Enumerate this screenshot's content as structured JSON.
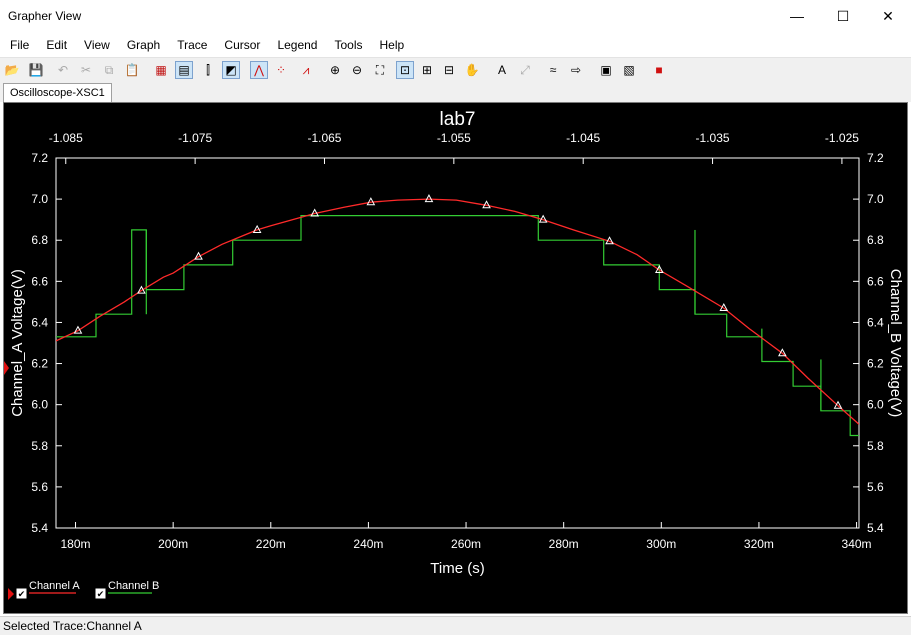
{
  "window": {
    "title": "Grapher View",
    "controls": {
      "minimize": "—",
      "maximize": "☐",
      "close": "✕"
    }
  },
  "menu": [
    "File",
    "Edit",
    "View",
    "Graph",
    "Trace",
    "Cursor",
    "Legend",
    "Tools",
    "Help"
  ],
  "toolbar": [
    {
      "icon": "open-folder-icon",
      "glyph": "📂"
    },
    {
      "icon": "save-icon",
      "glyph": "💾"
    },
    {
      "icon": "undo-icon",
      "glyph": "↶",
      "disabled": true
    },
    {
      "icon": "cut-icon",
      "glyph": "✂",
      "disabled": true
    },
    {
      "icon": "copy-icon",
      "glyph": "⧉",
      "disabled": true
    },
    {
      "icon": "paste-icon",
      "glyph": "📋",
      "disabled": true
    },
    {
      "icon": "grid-icon",
      "glyph": "▦"
    },
    {
      "icon": "legend-icon",
      "glyph": "▤",
      "active": true
    },
    {
      "icon": "cursors-icon",
      "glyph": "⫿"
    },
    {
      "icon": "reverse-colors-icon",
      "glyph": "◩",
      "active": true
    },
    {
      "icon": "line-trace-icon",
      "glyph": "⋀",
      "active": true
    },
    {
      "icon": "dot-trace-icon",
      "glyph": "⁘"
    },
    {
      "icon": "line-dot-trace-icon",
      "glyph": "⩘"
    },
    {
      "icon": "zoom-in-icon",
      "glyph": "⊕"
    },
    {
      "icon": "zoom-out-icon",
      "glyph": "⊖"
    },
    {
      "icon": "zoom-area-icon",
      "glyph": "⛶"
    },
    {
      "icon": "zoom-full-icon",
      "glyph": "⊡",
      "active": true
    },
    {
      "icon": "zoom-x-icon",
      "glyph": "⊞"
    },
    {
      "icon": "zoom-y-icon",
      "glyph": "⊟"
    },
    {
      "icon": "pan-icon",
      "glyph": "✋"
    },
    {
      "icon": "title-text-icon",
      "glyph": "A"
    },
    {
      "icon": "label-icon",
      "glyph": "⤢",
      "disabled": true
    },
    {
      "icon": "overlay-traces-icon",
      "glyph": "≈"
    },
    {
      "icon": "export-icon",
      "glyph": "⇨"
    },
    {
      "icon": "properties-icon",
      "glyph": "▣"
    },
    {
      "icon": "page-properties-icon",
      "glyph": "▧"
    },
    {
      "icon": "stop-icon",
      "glyph": "■"
    }
  ],
  "tabs": [
    {
      "label": "Oscilloscope-XSC1"
    }
  ],
  "status": {
    "text": "Selected Trace:Channel A"
  },
  "colors": {
    "background": "#000000",
    "axes": "#ffffff",
    "channel_a": "#ff2a2a",
    "channel_b": "#33cc33",
    "stop_button": "#d01010",
    "selected_marker": "#e01010"
  },
  "chart_data": {
    "type": "line",
    "title": "lab7",
    "xlabel": "Time (s)",
    "ylabel_left": "Channel_A Voltage(V)",
    "ylabel_right": "Channel_B Voltage(V)",
    "xlim": [
      0.176,
      0.3405
    ],
    "x_ticks": [
      "180m",
      "200m",
      "220m",
      "240m",
      "260m",
      "280m",
      "300m",
      "320m",
      "340m"
    ],
    "x_tick_values": [
      0.18,
      0.2,
      0.22,
      0.24,
      0.26,
      0.28,
      0.3,
      0.32,
      0.34
    ],
    "top_axis_ticks": [
      "-1.085",
      "-1.075",
      "-1.065",
      "-1.055",
      "-1.045",
      "-1.035",
      "-1.025"
    ],
    "top_axis_tick_values": [
      0.178,
      0.2045,
      0.231,
      0.2575,
      0.284,
      0.3105,
      0.337
    ],
    "ylim": [
      5.4,
      7.2
    ],
    "y_ticks": [
      5.4,
      5.6,
      5.8,
      6.0,
      6.2,
      6.4,
      6.6,
      6.8,
      7.0,
      7.2
    ],
    "y_tick_labels": [
      "5.4",
      "5.6",
      "5.8",
      "6.0",
      "6.2",
      "6.4",
      "6.6",
      "6.8",
      "7.0",
      "7.2"
    ],
    "grid": false,
    "legend_position": "bottom-left",
    "series": [
      {
        "name": "Channel A",
        "style": "line-with-triangle-markers",
        "x": [
          0.176,
          0.1805,
          0.185,
          0.19,
          0.1935,
          0.198,
          0.2,
          0.2052,
          0.21,
          0.2172,
          0.22,
          0.229,
          0.235,
          0.2405,
          0.246,
          0.2524,
          0.258,
          0.2642,
          0.27,
          0.2758,
          0.282,
          0.2894,
          0.295,
          0.2996,
          0.305,
          0.3128,
          0.318,
          0.3248,
          0.33,
          0.3362,
          0.3405
        ],
        "y": [
          6.31,
          6.36,
          6.43,
          6.5,
          6.555,
          6.62,
          6.64,
          6.72,
          6.78,
          6.85,
          6.87,
          6.93,
          6.96,
          6.985,
          6.995,
          7.0,
          6.995,
          6.97,
          6.94,
          6.9,
          6.85,
          6.795,
          6.73,
          6.655,
          6.58,
          6.47,
          6.37,
          6.25,
          6.13,
          5.995,
          5.905
        ],
        "markers_x": [
          0.1805,
          0.1935,
          0.2052,
          0.2172,
          0.229,
          0.2405,
          0.2524,
          0.2642,
          0.2758,
          0.2894,
          0.2996,
          0.3128,
          0.3248,
          0.3362
        ],
        "markers_y": [
          6.36,
          6.555,
          6.72,
          6.85,
          6.93,
          6.985,
          7.0,
          6.97,
          6.9,
          6.795,
          6.655,
          6.47,
          6.25,
          5.995
        ]
      },
      {
        "name": "Channel B",
        "style": "step",
        "x": [
          0.176,
          0.1842,
          0.1842,
          0.1915,
          0.1915,
          0.1945,
          0.1945,
          0.2022,
          0.2022,
          0.2122,
          0.2122,
          0.2262,
          0.2262,
          0.2748,
          0.2748,
          0.2882,
          0.2882,
          0.2996,
          0.2996,
          0.3069,
          0.3069,
          0.3134,
          0.3134,
          0.3206,
          0.3206,
          0.327,
          0.327,
          0.3327,
          0.3327,
          0.3387,
          0.3387,
          0.3405
        ],
        "y": [
          6.33,
          6.33,
          6.44,
          6.44,
          6.85,
          6.85,
          6.56,
          6.56,
          6.68,
          6.68,
          6.8,
          6.8,
          6.92,
          6.92,
          6.8,
          6.8,
          6.68,
          6.68,
          6.56,
          6.56,
          6.44,
          6.44,
          6.33,
          6.33,
          6.21,
          6.21,
          6.09,
          6.09,
          5.97,
          5.97,
          5.85,
          5.85
        ],
        "spikes": [
          {
            "x": 0.1945,
            "from": 6.44,
            "to": 6.85
          },
          {
            "x": 0.3069,
            "from": 6.44,
            "to": 6.85
          },
          {
            "x": 0.3206,
            "from": 6.33,
            "to": 6.37
          },
          {
            "x": 0.3327,
            "from": 5.97,
            "to": 6.22
          }
        ]
      }
    ]
  }
}
